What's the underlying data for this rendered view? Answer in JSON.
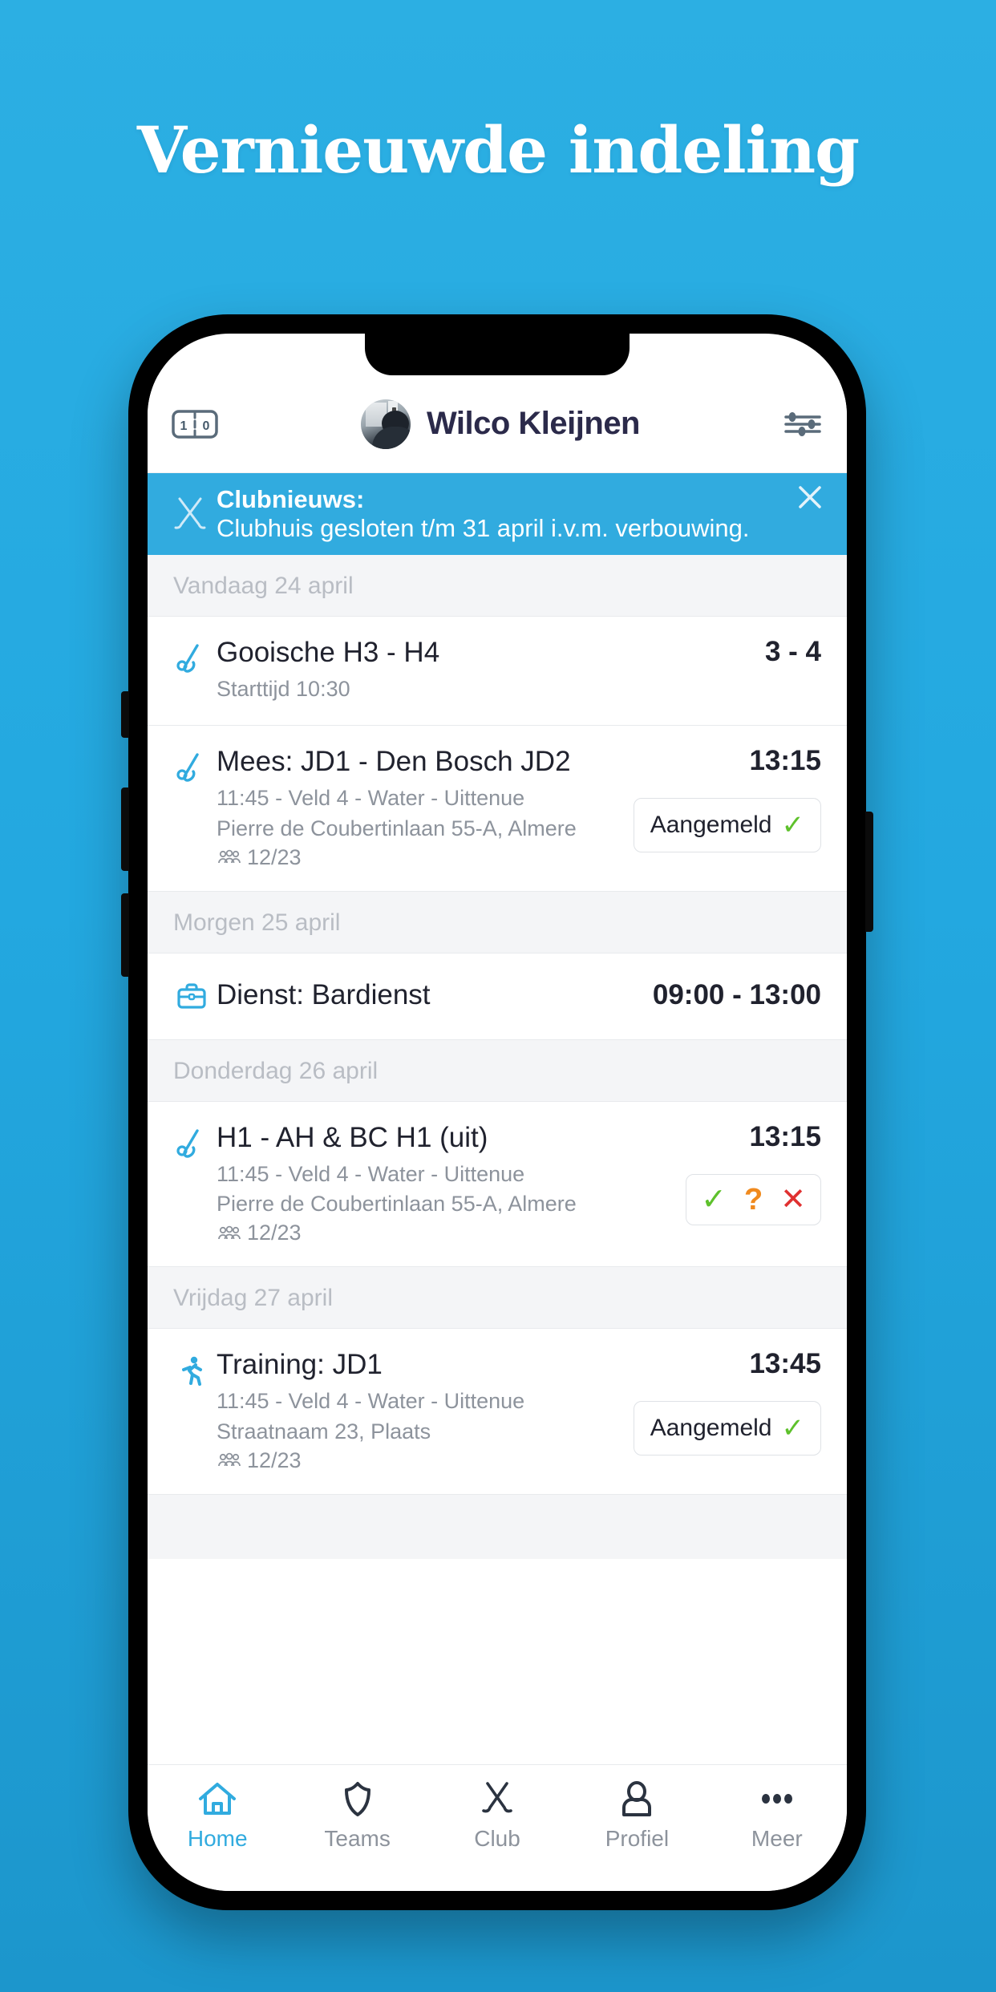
{
  "poster": {
    "title": "Vernieuwde indeling",
    "background_color": "#29ABE2"
  },
  "header": {
    "score_icon": "scoreboard-icon",
    "score_left": "1",
    "score_right": "0",
    "avatar": "user-avatar",
    "user_name": "Wilco Kleijnen",
    "filter_icon": "sliders-icon"
  },
  "banner": {
    "icon": "crossed-hockey-sticks-icon",
    "title": "Clubnieuws:",
    "body": "Clubhuis gesloten t/m 31 april i.v.m. verbouwing.",
    "close_icon": "close-icon",
    "background_color": "#31ABDF"
  },
  "feed": [
    {
      "day_label": "Vandaag 24 april",
      "events": [
        {
          "icon": "hockey-stick-ball-icon",
          "title": "Gooische H3 - H4",
          "lines": [
            "Starttijd 10:30"
          ],
          "attendance": null,
          "time": "3 - 4",
          "action": null
        },
        {
          "icon": "hockey-stick-ball-icon",
          "title": "Mees: JD1 - Den Bosch JD2",
          "lines": [
            "11:45 - Veld 4 - Water - Uittenue",
            "Pierre de Coubertinlaan 55-A, Almere"
          ],
          "attendance": "12/23",
          "time": "13:15",
          "action": {
            "type": "pill",
            "label": "Aangemeld",
            "check": "✓"
          }
        }
      ]
    },
    {
      "day_label": "Morgen 25 april",
      "events": [
        {
          "icon": "briefcase-icon",
          "title": "Dienst: Bardienst",
          "lines": [],
          "attendance": null,
          "time": "09:00 - 13:00",
          "action": null
        }
      ]
    },
    {
      "day_label": "Donderdag 26 april",
      "events": [
        {
          "icon": "hockey-stick-ball-icon",
          "title": "H1 - AH & BC H1 (uit)",
          "lines": [
            "11:45 - Veld 4 - Water - Uittenue",
            "Pierre de Coubertinlaan 55-A, Almere"
          ],
          "attendance": "12/23",
          "time": "13:15",
          "action": {
            "type": "rsvp",
            "yes": "✓",
            "maybe": "?",
            "no": "✕"
          }
        }
      ]
    },
    {
      "day_label": "Vrijdag 27 april",
      "events": [
        {
          "icon": "running-person-icon",
          "title": "Training: JD1",
          "lines": [
            "11:45 - Veld 4 - Water - Uittenue",
            "Straatnaam 23, Plaats"
          ],
          "attendance": "12/23",
          "time": "13:45",
          "action": {
            "type": "pill",
            "label": "Aangemeld",
            "check": "✓"
          }
        }
      ]
    }
  ],
  "tabbar": {
    "active_color": "#31ABDF",
    "tabs": [
      {
        "label": "Home",
        "icon": "home-icon",
        "active": true
      },
      {
        "label": "Teams",
        "icon": "shield-icon",
        "active": false
      },
      {
        "label": "Club",
        "icon": "crossed-hockey-sticks-icon",
        "active": false
      },
      {
        "label": "Profiel",
        "icon": "person-icon",
        "active": false
      },
      {
        "label": "Meer",
        "icon": "ellipsis-icon",
        "active": false
      }
    ]
  }
}
